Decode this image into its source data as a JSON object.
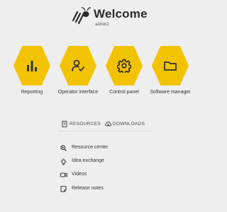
{
  "header": {
    "title": "Welcome",
    "username": "admin2"
  },
  "tiles": [
    {
      "label": "Reporting",
      "icon": "bar-chart-icon"
    },
    {
      "label": "Operator interface",
      "icon": "user-check-icon"
    },
    {
      "label": "Control panel",
      "icon": "gear-icon"
    },
    {
      "label": "Software manager",
      "icon": "folder-icon"
    }
  ],
  "tabs": [
    {
      "label": "RESOURCES",
      "icon": "document-icon",
      "active": true
    },
    {
      "label": "DOWNLOADS",
      "icon": "cloud-download-icon",
      "active": false
    }
  ],
  "resources": [
    {
      "label": "Resource center",
      "icon": "search-icon"
    },
    {
      "label": "Idea exchange",
      "icon": "lightbulb-icon"
    },
    {
      "label": "Videos",
      "icon": "video-icon"
    },
    {
      "label": "Release notes",
      "icon": "notes-icon"
    }
  ],
  "colors": {
    "accent": "#f2c300",
    "background": "#eeeeee",
    "icon": "#333333"
  }
}
